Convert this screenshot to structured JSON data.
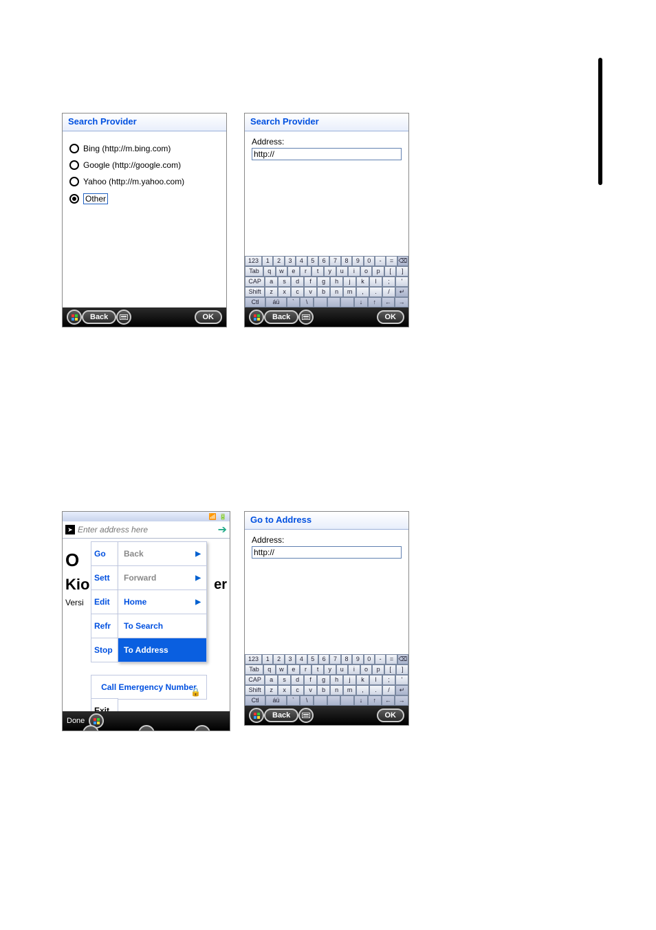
{
  "vbar_text": "|",
  "screen1": {
    "title": "Search Provider",
    "options": [
      {
        "label": "Bing (http://m.bing.com)",
        "selected": false
      },
      {
        "label": "Google (http://google.com)",
        "selected": false
      },
      {
        "label": "Yahoo (http://m.yahoo.com)",
        "selected": false
      },
      {
        "label": "Other",
        "selected": true
      }
    ],
    "back": "Back",
    "ok": "OK"
  },
  "screen2": {
    "title": "Search Provider",
    "address_label": "Address:",
    "address_value": "http://",
    "back": "Back",
    "ok": "OK"
  },
  "screen3": {
    "address_placeholder": "Enter address here",
    "bg1": "O",
    "bg2": "Kio",
    "bg3": "er",
    "bg4": "Versi",
    "menu_left": [
      "Go",
      "Sett",
      "Edit",
      "Refr",
      "Stop"
    ],
    "exit": "Exit",
    "submenu": [
      {
        "label": "Back",
        "state": "disabled",
        "arrow": true
      },
      {
        "label": "Forward",
        "state": "disabled",
        "arrow": true
      },
      {
        "label": "Home",
        "state": "active",
        "arrow": true
      },
      {
        "label": "To Search",
        "state": "active",
        "arrow": false
      },
      {
        "label": "To Address",
        "state": "selected",
        "arrow": false
      }
    ],
    "emergency": "Call Emergency Number",
    "done": "Done"
  },
  "screen4": {
    "title": "Go to Address",
    "address_label": "Address:",
    "address_value": "http://",
    "back": "Back",
    "ok": "OK"
  },
  "keyboard": {
    "rows": [
      [
        "123",
        "1",
        "2",
        "3",
        "4",
        "5",
        "6",
        "7",
        "8",
        "9",
        "0",
        "-",
        "=",
        "⌫"
      ],
      [
        "Tab",
        "q",
        "w",
        "e",
        "r",
        "t",
        "y",
        "u",
        "i",
        "o",
        "p",
        "[",
        "]"
      ],
      [
        "CAP",
        "a",
        "s",
        "d",
        "f",
        "g",
        "h",
        "j",
        "k",
        "l",
        ";",
        "'"
      ],
      [
        "Shift",
        "z",
        "x",
        "c",
        "v",
        "b",
        "n",
        "m",
        ",",
        ".",
        "/",
        "↵"
      ],
      [
        "Ctl",
        "áü",
        "`",
        "\\",
        " ",
        " ",
        " ",
        "↓",
        "↑",
        "←",
        "→"
      ]
    ]
  }
}
